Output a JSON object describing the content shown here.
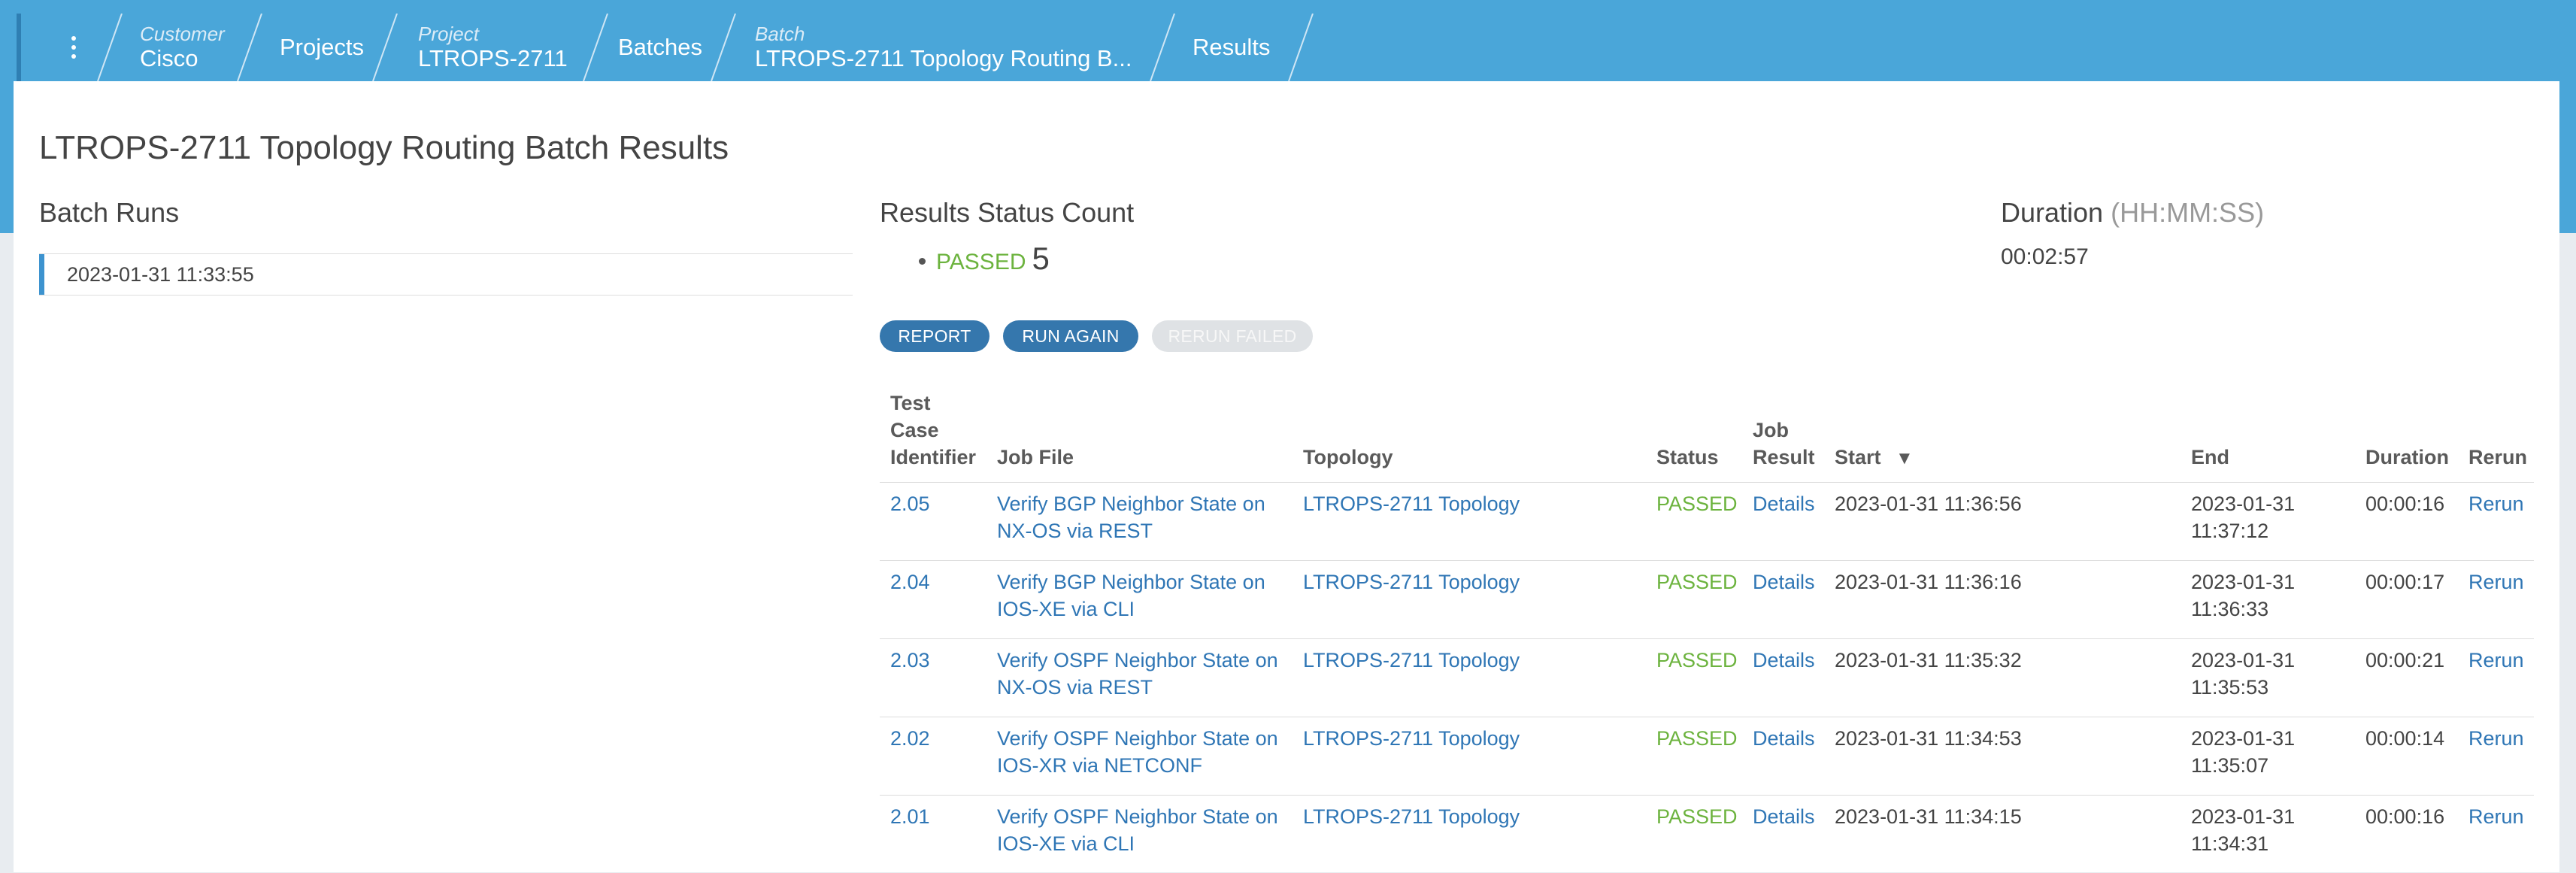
{
  "breadcrumbs": [
    {
      "small": "Customer",
      "label": "Cisco"
    },
    {
      "small": "",
      "label": "Projects"
    },
    {
      "small": "Project",
      "label": "LTROPS-2711"
    },
    {
      "small": "",
      "label": "Batches"
    },
    {
      "small": "Batch",
      "label": "LTROPS-2711 Topology Routing B..."
    },
    {
      "small": "",
      "label": "Results"
    }
  ],
  "page_title": "LTROPS-2711 Topology Routing Batch Results",
  "batch_runs": {
    "heading": "Batch Runs",
    "items": [
      "2023-01-31 11:33:55"
    ]
  },
  "status_count": {
    "heading": "Results Status Count",
    "items": [
      {
        "label": "PASSED",
        "count": "5"
      }
    ]
  },
  "duration": {
    "heading": "Duration",
    "unit": "(HH:MM:SS)",
    "value": "00:02:57"
  },
  "buttons": {
    "report": "REPORT",
    "run_again": "RUN AGAIN",
    "rerun_failed": "RERUN FAILED"
  },
  "table": {
    "headers": {
      "id": [
        "Test",
        "Case",
        "Identifier"
      ],
      "job_file": "Job File",
      "topology": "Topology",
      "status": "Status",
      "job_result": [
        "Job",
        "Result"
      ],
      "start": "Start",
      "start_sort": "▼",
      "end": "End",
      "duration": "Duration",
      "rerun": "Rerun"
    },
    "rows": [
      {
        "id": "2.05",
        "job_file": [
          "Verify BGP Neighbor State on",
          "NX-OS via REST"
        ],
        "topology": "LTROPS-2711 Topology",
        "status": "PASSED",
        "result": "Details",
        "start": "2023-01-31 11:36:56",
        "end": [
          "2023-01-31",
          "11:37:12"
        ],
        "duration": "00:00:16",
        "rerun": "Rerun"
      },
      {
        "id": "2.04",
        "job_file": [
          "Verify BGP Neighbor State on",
          "IOS-XE via CLI"
        ],
        "topology": "LTROPS-2711 Topology",
        "status": "PASSED",
        "result": "Details",
        "start": "2023-01-31 11:36:16",
        "end": [
          "2023-01-31",
          "11:36:33"
        ],
        "duration": "00:00:17",
        "rerun": "Rerun"
      },
      {
        "id": "2.03",
        "job_file": [
          "Verify OSPF Neighbor State on",
          "NX-OS via REST"
        ],
        "topology": "LTROPS-2711 Topology",
        "status": "PASSED",
        "result": "Details",
        "start": "2023-01-31 11:35:32",
        "end": [
          "2023-01-31",
          "11:35:53"
        ],
        "duration": "00:00:21",
        "rerun": "Rerun"
      },
      {
        "id": "2.02",
        "job_file": [
          "Verify OSPF Neighbor State on",
          "IOS-XR via NETCONF"
        ],
        "topology": "LTROPS-2711 Topology",
        "status": "PASSED",
        "result": "Details",
        "start": "2023-01-31 11:34:53",
        "end": [
          "2023-01-31",
          "11:35:07"
        ],
        "duration": "00:00:14",
        "rerun": "Rerun"
      },
      {
        "id": "2.01",
        "job_file": [
          "Verify OSPF Neighbor State on",
          "IOS-XE via CLI"
        ],
        "topology": "LTROPS-2711 Topology",
        "status": "PASSED",
        "result": "Details",
        "start": "2023-01-31 11:34:15",
        "end": [
          "2023-01-31",
          "11:34:31"
        ],
        "duration": "00:00:16",
        "rerun": "Rerun"
      }
    ]
  },
  "colors": {
    "header_blue": "#4aa6d9",
    "passed_green": "#6cb33e",
    "link_blue": "#2f76b5",
    "button_blue": "#3577ad"
  }
}
